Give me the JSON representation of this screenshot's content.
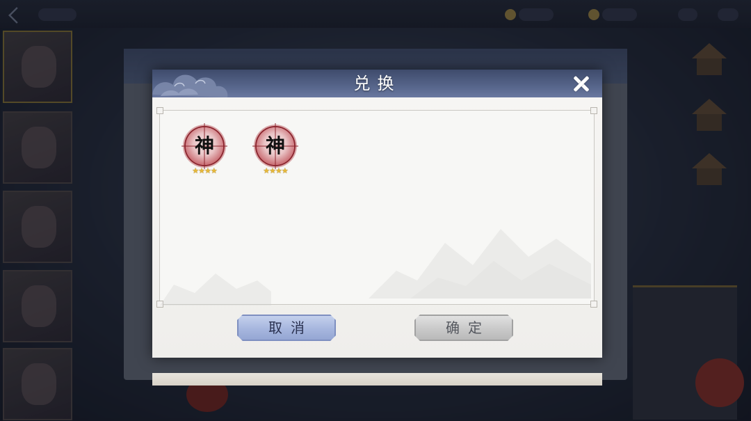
{
  "dialog": {
    "title": "兑换",
    "close_icon": "close-icon"
  },
  "rewards": [
    {
      "glyph": "神",
      "stars": "★★★★",
      "star_count": 4,
      "icon": "shen-token-icon"
    },
    {
      "glyph": "神",
      "stars": "★★★★",
      "star_count": 4,
      "icon": "shen-token-icon"
    }
  ],
  "buttons": {
    "cancel_label": "取消",
    "confirm_label": "确定"
  },
  "colors": {
    "header": "#4d5a7d",
    "cancel_button": "#a6b6de",
    "confirm_button": "#c9c9c9",
    "token_red": "#9c2f36",
    "star": "#e7b93a"
  }
}
